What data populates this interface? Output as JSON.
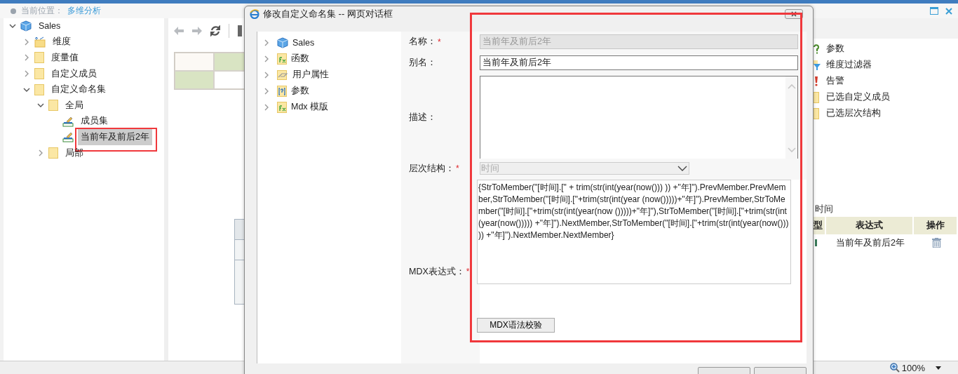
{
  "breadcrumb": {
    "label": "当前位置：",
    "current": "多维分析"
  },
  "tree": [
    {
      "label": "Sales",
      "kind": "cube",
      "expanded": true,
      "selected": false,
      "children": [
        {
          "label": "维度",
          "kind": "dimension",
          "expanded": false,
          "selected": false
        },
        {
          "label": "度量值",
          "kind": "folder",
          "expanded": false,
          "selected": false
        },
        {
          "label": "自定义成员",
          "kind": "folder",
          "expanded": false,
          "selected": false
        },
        {
          "label": "自定义命名集",
          "kind": "folder",
          "expanded": true,
          "selected": false,
          "children": [
            {
              "label": "全局",
              "kind": "folder",
              "expanded": true,
              "selected": false,
              "children": [
                {
                  "label": "成员集",
                  "kind": "namedset",
                  "selected": false
                },
                {
                  "label": "当前年及前后2年",
                  "kind": "namedset",
                  "selected": true
                }
              ]
            },
            {
              "label": "局部",
              "kind": "folder",
              "expanded": false,
              "selected": false
            }
          ]
        }
      ]
    }
  ],
  "right_panel": {
    "items": [
      {
        "label": "参数",
        "kind": "parameter"
      },
      {
        "label": "维度过滤器",
        "kind": "filter"
      },
      {
        "label": "告警",
        "kind": "alert"
      },
      {
        "label": "已选自定义成员",
        "kind": "folder"
      },
      {
        "label": "已选层次结构",
        "kind": "folder"
      }
    ],
    "hierarchy_label": "时间",
    "table": {
      "columns": [
        "型",
        "表达式",
        "操作"
      ],
      "rows": [
        {
          "expression": "当前年及前后2年"
        }
      ]
    }
  },
  "status_bar": {
    "zoom": "100%"
  },
  "dialog": {
    "title": "修改自定义命名集 -- 网页对话框",
    "tree": [
      {
        "label": "Sales",
        "kind": "cube",
        "expanded": false
      },
      {
        "label": "函数",
        "kind": "function",
        "expanded": false
      },
      {
        "label": "用户属性",
        "kind": "attribute",
        "expanded": false
      },
      {
        "label": "参数",
        "kind": "parameter",
        "expanded": false
      },
      {
        "label": "Mdx 模版",
        "kind": "function",
        "expanded": false
      }
    ],
    "form": [
      {
        "kind": "text",
        "label": "名称：",
        "required_mark": "*",
        "value": "当前年及前后2年",
        "disabled": true
      },
      {
        "kind": "text",
        "label": "别名：",
        "value": "当前年及前后2年",
        "disabled": false
      },
      {
        "kind": "textarea",
        "label": "描述："
      },
      {
        "kind": "select",
        "label": "层次结构：",
        "required_mark": "*",
        "value": "时间",
        "disabled": true
      },
      {
        "kind": "code",
        "label": "MDX表达式：",
        "required_mark": "*",
        "value": "{StrToMember(\"[时间].[\" + trim(str(int(year(now())) )) +\"年]\").PrevMember.PrevMember,StrToMember(\"[时间].[\"+trim(str(int(year (now()))))+\"年]\").PrevMember,StrToMember(\"[时间].[\"+trim(str(int(year(now ()))))+\"年]\"),StrToMember(\"[时间].[\"+trim(str(int(year(now())))) +\"年]\").NextMember,StrToMember(\"[时间].[\"+trim(str(int(year(now())) )) +\"年]\").NextMember.NextMember}",
        "button": "MDX语法校验"
      }
    ]
  }
}
